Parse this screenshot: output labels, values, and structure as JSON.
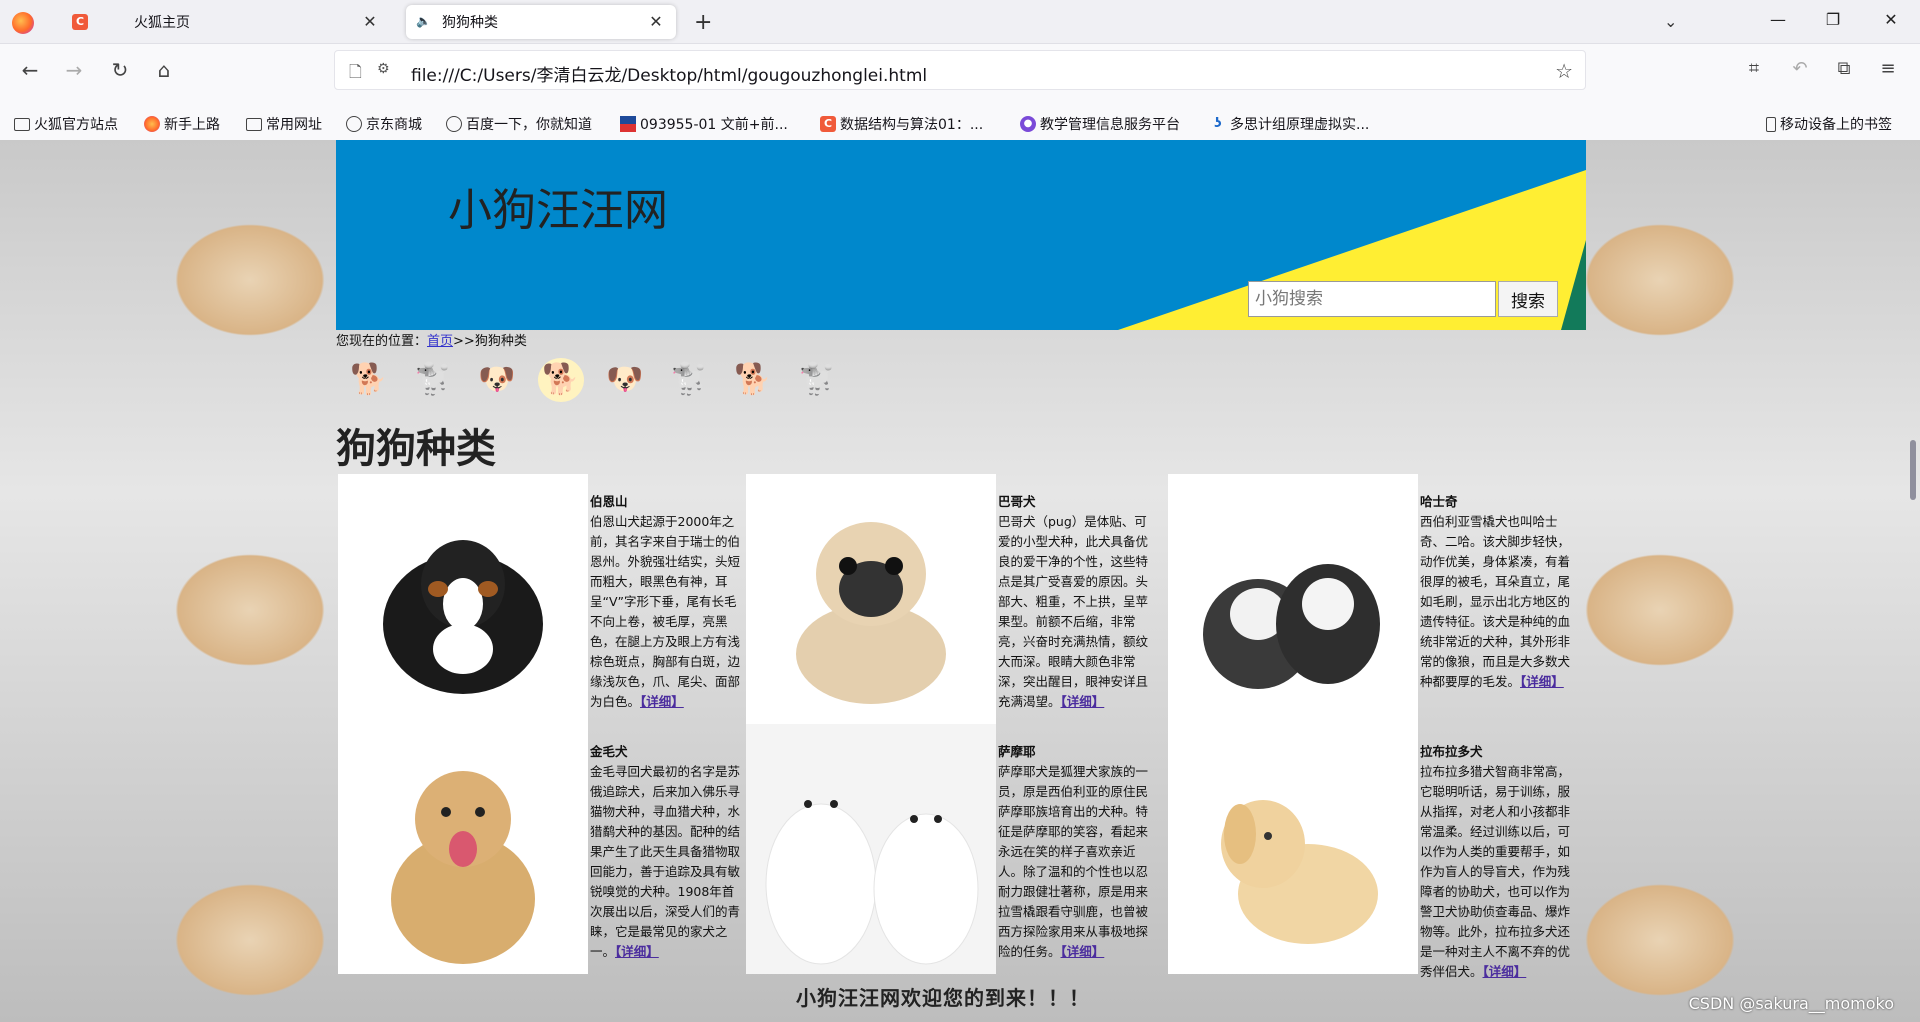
{
  "browser": {
    "tabs": [
      {
        "label": "火狐主页"
      },
      {
        "label": "狗狗种类"
      }
    ],
    "url": "file:///C:/Users/李清白云龙/Desktop/html/gougouzhonglei.html",
    "bookmarks": [
      {
        "label": "火狐官方站点",
        "icon": "folder-icon"
      },
      {
        "label": "新手上路",
        "icon": "firefox-icon"
      },
      {
        "label": "常用网址",
        "icon": "folder-icon"
      },
      {
        "label": "京东商城",
        "icon": "globe-icon"
      },
      {
        "label": "百度一下，你就知道",
        "icon": "globe-icon"
      },
      {
        "label": "093955-01 文前+前...",
        "icon": "flag-icon"
      },
      {
        "label": "数据结构与算法01：...",
        "icon": "c-icon"
      },
      {
        "label": "教学管理信息服务平台",
        "icon": "purple-icon"
      },
      {
        "label": "多思计组原理虚拟实...",
        "icon": "blue-icon"
      }
    ],
    "mobile_bookmarks": "移动设备上的书签"
  },
  "page": {
    "site_title": "小狗汪汪网",
    "search": {
      "placeholder": "小狗搜索",
      "button": "搜索"
    },
    "breadcrumb": {
      "prefix": "您现在的位置：",
      "home": "首页",
      "current": ">>狗狗种类"
    },
    "section_title": "狗狗种类",
    "detail_link": "【详细】",
    "breeds": [
      {
        "name": "伯恩山",
        "desc": "伯恩山犬起源于2000年之前，其名字来自于瑞士的伯恩州。外貌强壮结实，头短而粗大，眼黑色有神，耳呈“V”字形下垂，尾有长毛不向上卷，被毛厚，亮黑色，在腿上方及眼上方有浅棕色斑点，胸部有白斑，边缘浅灰色，爪、尾尖、面部为白色。"
      },
      {
        "name": "巴哥犬",
        "desc": "巴哥犬（pug）是体贴、可爱的小型犬种，此犬具备优良的爱干净的个性，这些特点是其广受喜爱的原因。头部大、粗重，不上拱，呈苹果型。前额不后缩，非常亮，兴奋时充满热情，额纹大而深。眼睛大颜色非常深，突出醒目，眼神安详且充满渴望。"
      },
      {
        "name": "哈士奇",
        "desc": "西伯利亚雪橇犬也叫哈士奇、二哈。该犬脚步轻快，动作优美，身体紧凑，有着很厚的被毛，耳朵直立，尾如毛刷，显示出北方地区的遗传特征。该犬是种纯的血统非常近的犬种，其外形非常的像狼，而且是大多数犬种都要厚的毛发。"
      },
      {
        "name": "金毛犬",
        "desc": "金毛寻回犬最初的名字是苏俄追踪犬，后来加入佛乐寻猫物犬种，寻血猎犬种，水猎鹬犬种的基因。配种的结果产生了此天生具备猎物取回能力，善于追踪及具有敏锐嗅觉的犬种。1908年首次展出以后，深受人们的青睐，它是最常见的家犬之一。"
      },
      {
        "name": "萨摩耶",
        "desc": "萨摩耶犬是狐狸犬家族的一员，原是西伯利亚的原住民萨摩耶族培育出的犬种。特征是萨摩耶的笑容，看起来永远在笑的样子喜欢亲近人。除了温和的个性也以忍耐力跟健壮著称，原是用来拉雪橇跟看守驯鹿，也曾被西方探险家用来从事极地探险的任务。"
      },
      {
        "name": "拉布拉多犬",
        "desc": "拉布拉多猎犬智商非常高，它聪明听话，易于训练，服从指挥，对老人和小孩都非常温柔。经过训练以后，可以作为人类的重要帮手，如作为盲人的导盲犬，作为残障者的协助犬，也可以作为警卫犬协助侦查毒品、爆炸物等。此外，拉布拉多犬还是一种对主人不离不弃的优秀伴侣犬。"
      }
    ],
    "footer": "小狗汪汪网欢迎您的到来！！！",
    "watermark": "CSDN @sakura__momoko"
  }
}
